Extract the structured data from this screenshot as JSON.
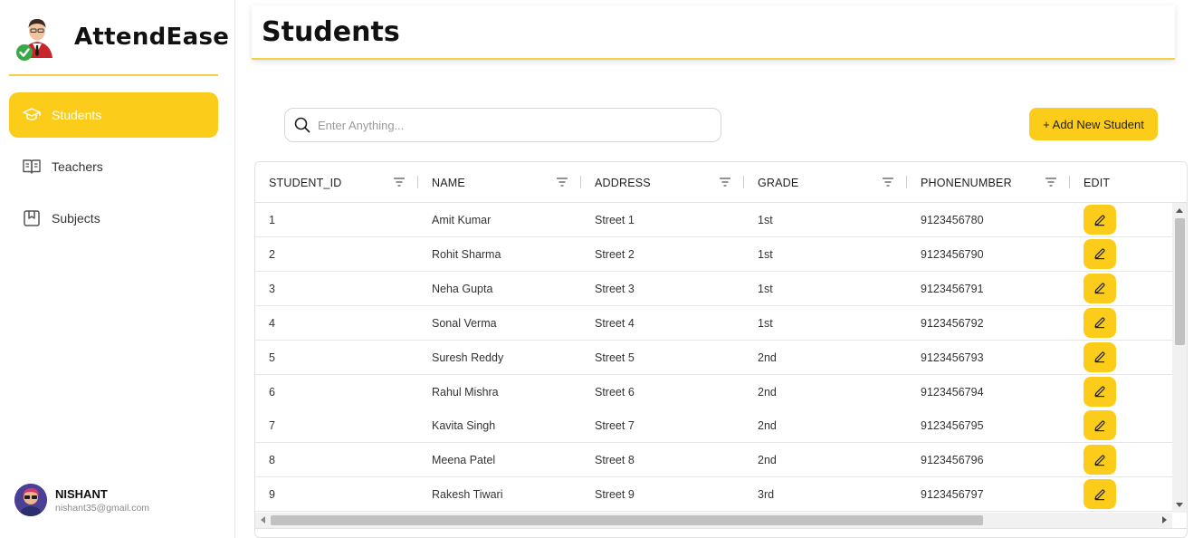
{
  "app": {
    "name": "AttendEase"
  },
  "sidebar": {
    "items": [
      {
        "label": "Students",
        "icon": "graduation-cap-icon",
        "active": true
      },
      {
        "label": "Teachers",
        "icon": "book-open-icon",
        "active": false
      },
      {
        "label": "Subjects",
        "icon": "bookmark-book-icon",
        "active": false
      }
    ]
  },
  "user": {
    "name": "NISHANT",
    "email": "nishant35@gmail.com"
  },
  "header": {
    "title": "Students"
  },
  "toolbar": {
    "search_placeholder": "Enter Anything...",
    "search_value": "",
    "add_label": "+ Add New Student"
  },
  "table": {
    "columns": [
      "STUDENT_ID",
      "NAME",
      "ADDRESS",
      "GRADE",
      "PHONENUMBER",
      "EDIT"
    ],
    "rows": [
      {
        "id": "1",
        "name": "Amit Kumar",
        "address": "Street 1",
        "grade": "1st",
        "phone": "9123456780"
      },
      {
        "id": "2",
        "name": "Rohit Sharma",
        "address": "Street 2",
        "grade": "1st",
        "phone": "9123456790"
      },
      {
        "id": "3",
        "name": "Neha Gupta",
        "address": "Street 3",
        "grade": "1st",
        "phone": "9123456791"
      },
      {
        "id": "4",
        "name": "Sonal Verma",
        "address": "Street 4",
        "grade": "1st",
        "phone": "9123456792"
      },
      {
        "id": "5",
        "name": "Suresh Reddy",
        "address": "Street 5",
        "grade": "2nd",
        "phone": "9123456793"
      },
      {
        "id": "6",
        "name": "Rahul Mishra",
        "address": "Street 6",
        "grade": "2nd",
        "phone": "9123456794"
      },
      {
        "id": "7",
        "name": "Kavita Singh",
        "address": "Street 7",
        "grade": "2nd",
        "phone": "9123456795"
      },
      {
        "id": "8",
        "name": "Meena Patel",
        "address": "Street 8",
        "grade": "2nd",
        "phone": "9123456796"
      },
      {
        "id": "9",
        "name": "Rakesh Tiwari",
        "address": "Street 9",
        "grade": "3rd",
        "phone": "9123456797"
      }
    ]
  },
  "colors": {
    "accent": "#fbcd1a",
    "accent_border": "#f2cf4a"
  }
}
